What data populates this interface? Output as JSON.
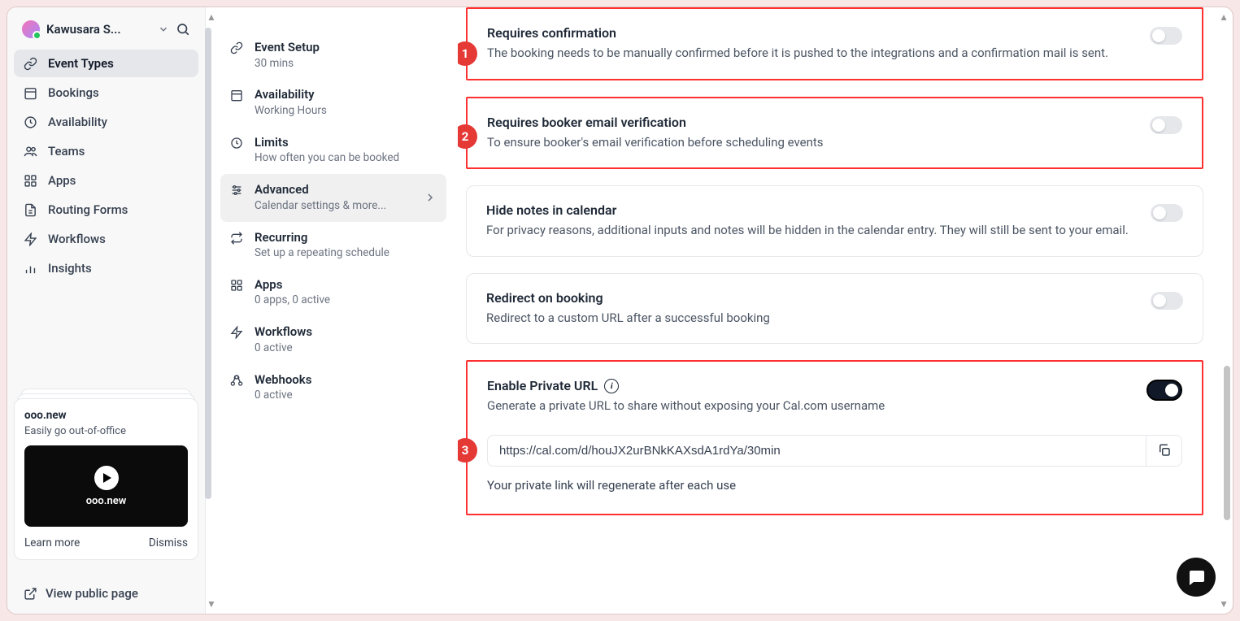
{
  "user": {
    "name": "Kawusara S..."
  },
  "nav": {
    "event_types": "Event Types",
    "bookings": "Bookings",
    "availability": "Availability",
    "teams": "Teams",
    "apps": "Apps",
    "routing_forms": "Routing Forms",
    "workflows": "Workflows",
    "insights": "Insights"
  },
  "promo": {
    "title": "ooo.new",
    "desc": "Easily go out-of-office",
    "video_label": "ooo.new",
    "learn_more": "Learn more",
    "dismiss": "Dismiss"
  },
  "public_page": "View public page",
  "secnav": {
    "setup": {
      "title": "Event Setup",
      "sub": "30 mins"
    },
    "availability": {
      "title": "Availability",
      "sub": "Working Hours"
    },
    "limits": {
      "title": "Limits",
      "sub": "How often you can be booked"
    },
    "advanced": {
      "title": "Advanced",
      "sub": "Calendar settings & more..."
    },
    "recurring": {
      "title": "Recurring",
      "sub": "Set up a repeating schedule"
    },
    "apps": {
      "title": "Apps",
      "sub": "0 apps, 0 active"
    },
    "workflows": {
      "title": "Workflows",
      "sub": "0 active"
    },
    "webhooks": {
      "title": "Webhooks",
      "sub": "0 active"
    }
  },
  "cards": {
    "confirm": {
      "title": "Requires confirmation",
      "desc": "The booking needs to be manually confirmed before it is pushed to the integrations and a confirmation mail is sent."
    },
    "verify": {
      "title": "Requires booker email verification",
      "desc": "To ensure booker's email verification before scheduling events"
    },
    "hide_notes": {
      "title": "Hide notes in calendar",
      "desc": "For privacy reasons, additional inputs and notes will be hidden in the calendar entry. They will still be sent to your email."
    },
    "redirect": {
      "title": "Redirect on booking",
      "desc": "Redirect to a custom URL after a successful booking"
    },
    "private": {
      "title": "Enable Private URL",
      "desc": "Generate a private URL to share without exposing your Cal.com username",
      "url": "https://cal.com/d/houJX2urBNkKAXsdA1rdYa/30min",
      "note": "Your private link will regenerate after each use"
    }
  },
  "badges": {
    "one": "1",
    "two": "2",
    "three": "3"
  }
}
